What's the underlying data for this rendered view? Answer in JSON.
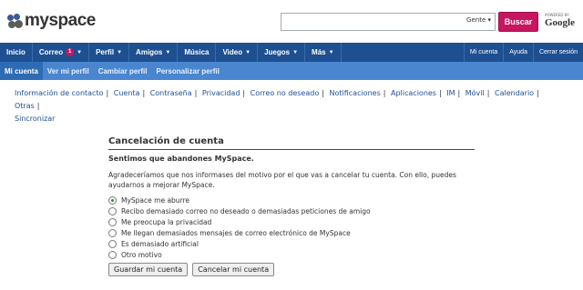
{
  "header": {
    "logo_text": "myspace",
    "search_placeholder": "",
    "search_scope": "Gente ▾",
    "search_button": "Buscar",
    "powered_by": "POWERED BY",
    "google": "Google"
  },
  "nav": {
    "items": [
      {
        "label": "Inicio"
      },
      {
        "label": "Correo",
        "badge": "1"
      },
      {
        "label": "Perfil"
      },
      {
        "label": "Amigos"
      },
      {
        "label": "Música"
      },
      {
        "label": "Video"
      },
      {
        "label": "Juegos"
      },
      {
        "label": "Más"
      }
    ],
    "right": [
      "Mi cuenta",
      "Ayuda",
      "Cerrar sesión"
    ]
  },
  "subnav": {
    "items": [
      "Mi cuenta",
      "Ver mi perfil",
      "Cambiar perfil",
      "Personalizar perfil"
    ]
  },
  "links": [
    "Información de contacto",
    "Cuenta",
    "Contraseña",
    "Privacidad",
    "Correo no deseado",
    "Notificaciones",
    "Aplicaciones",
    "IM",
    "Móvil",
    "Calendario",
    "Otras",
    "Sincronizar"
  ],
  "panel": {
    "title": "Cancelación de cuenta",
    "subtitle": "Sentimos que abandones MySpace.",
    "description": "Agradeceríamos que nos informases del motivo por el que vas a cancelar tu cuenta. Con ello, puedes ayudarnos a mejorar MySpace.",
    "options": [
      {
        "label": "MySpace me aburre",
        "checked": true
      },
      {
        "label": "Recibo demasiado correo no deseado o demasiadas peticiones de amigo",
        "checked": false
      },
      {
        "label": "Me preocupa la privacidad",
        "checked": false
      },
      {
        "label": "Me llegan demasiados mensajes de correo electrónico de MySpace",
        "checked": false
      },
      {
        "label": "Es demasiado artificial",
        "checked": false
      },
      {
        "label": "Otro motivo",
        "checked": false
      }
    ],
    "save_button": "Guardar mi cuenta",
    "cancel_button": "Cancelar mi cuenta"
  },
  "colors": {
    "nav_bg": "#1d4f91",
    "subnav_bg": "#4a86cf",
    "brand_pink": "#c7165f"
  }
}
